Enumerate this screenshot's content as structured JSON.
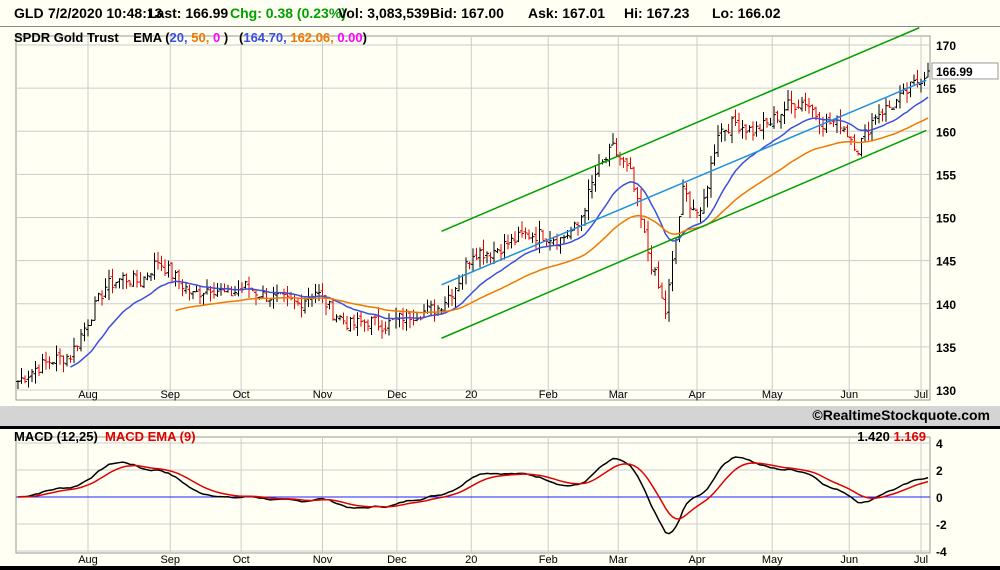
{
  "quote": {
    "symbol": "GLD",
    "datetime": "7/2/2020 10:48:13",
    "last": "Last: 166.99",
    "chg": "Chg: 0.38 (0.23%)",
    "vol": "Vol: 3,083,539",
    "bid": "Bid: 167.00",
    "ask": "Ask: 167.01",
    "hi": "Hi: 167.23",
    "lo": "Lo: 166.02"
  },
  "header": {
    "name": "SPDR Gold Trust",
    "ema_label": "EMA (",
    "p1": "20,",
    "p2": "50,",
    "p3": "0",
    "close1": ")",
    "open2": "(",
    "v1": "164.70,",
    "v2": "162.06,",
    "v3": "0.00",
    "close2": ")"
  },
  "copyright": "©RealtimeStockquote.com",
  "macd": {
    "label": "MACD (12,25)",
    "ema_label": "MACD EMA (9)",
    "value": "1.420",
    "signal": "1.169"
  },
  "colors": {
    "ema20": "#3b4fe0",
    "ema50": "#f07800",
    "ema0": "#ff00ff",
    "channel": "#00a000",
    "midline": "#1e90e0",
    "up": "#000000",
    "down": "#e00000",
    "macd": "#000000",
    "signal": "#e00000",
    "zero": "#2020ff"
  },
  "chart_data": [
    {
      "type": "ohlc",
      "title": "GLD",
      "ylim": [
        130,
        170
      ],
      "yticks": [
        130,
        135,
        140,
        145,
        150,
        155,
        160,
        165,
        170
      ],
      "last_label": "166.99",
      "last": 166.99,
      "xlabels": [
        {
          "t": "Aug",
          "w": 4
        },
        {
          "t": "Sep",
          "w": 8.7
        },
        {
          "t": "Oct",
          "w": 12.75
        },
        {
          "t": "Nov",
          "w": 17.4
        },
        {
          "t": "Dec",
          "w": 21.65
        },
        {
          "t": "20",
          "w": 25.9
        },
        {
          "t": "Feb",
          "w": 30.3
        },
        {
          "t": "Mar",
          "w": 34.3
        },
        {
          "t": "Apr",
          "w": 38.8
        },
        {
          "t": "May",
          "w": 43.1
        },
        {
          "t": "Jun",
          "w": 47.5
        },
        {
          "t": "Jul",
          "w": 51.6
        }
      ],
      "weekly_closes": [
        131,
        132.5,
        133.5,
        134,
        138,
        142,
        143,
        142.5,
        145,
        143,
        141,
        142,
        141,
        142,
        141,
        140.5,
        140,
        141.5,
        139,
        137.5,
        138,
        137.5,
        138.5,
        139,
        139.5,
        142,
        146,
        146,
        147,
        148,
        148,
        147.5,
        149,
        155,
        158,
        155,
        146,
        139,
        153,
        150,
        160,
        161,
        160,
        161,
        163,
        163.5,
        161,
        161,
        158,
        162,
        163,
        165,
        167
      ],
      "trendlines": [
        {
          "name": "upper",
          "from": [
            24.2,
            148.4
          ],
          "to": [
            51.5,
            172
          ]
        },
        {
          "name": "lower",
          "from": [
            24.2,
            136
          ],
          "to": [
            51.9,
            160.1
          ]
        },
        {
          "name": "mid",
          "from": [
            24.2,
            142.2
          ],
          "to": [
            51.9,
            165.9
          ]
        }
      ]
    },
    {
      "type": "line",
      "title": "MACD (12,25)",
      "ylim": [
        -4,
        4
      ],
      "yticks": [
        -4,
        -2,
        0,
        2,
        4
      ]
    }
  ]
}
